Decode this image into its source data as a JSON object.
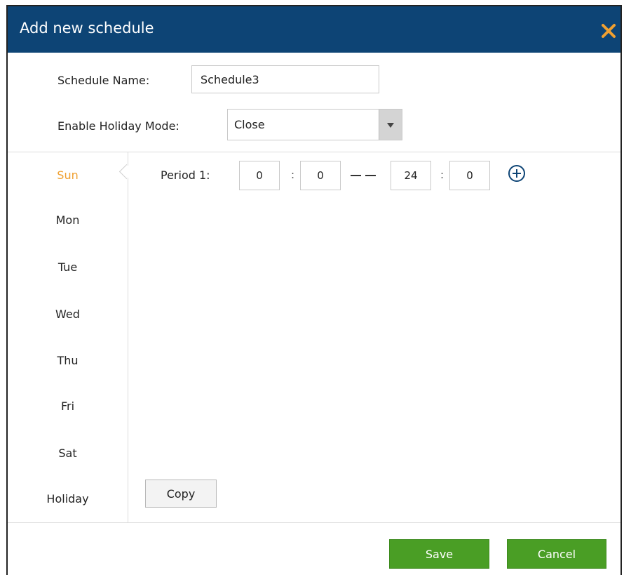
{
  "dialog": {
    "title": "Add new schedule",
    "close_icon": "close-x-icon",
    "accent_color": "#f0a030",
    "header_color": "#0d4475"
  },
  "form": {
    "schedule_name_label": "Schedule Name:",
    "schedule_name_value": "Schedule3",
    "holiday_mode_label": "Enable Holiday Mode:",
    "holiday_mode_value": "Close"
  },
  "days": [
    {
      "label": "Sun",
      "active": true
    },
    {
      "label": "Mon",
      "active": false
    },
    {
      "label": "Tue",
      "active": false
    },
    {
      "label": "Wed",
      "active": false
    },
    {
      "label": "Thu",
      "active": false
    },
    {
      "label": "Fri",
      "active": false
    },
    {
      "label": "Sat",
      "active": false
    },
    {
      "label": "Holiday",
      "active": false
    }
  ],
  "period": {
    "label": "Period 1:",
    "start_hour": "0",
    "start_minute": "0",
    "end_hour": "24",
    "end_minute": "0",
    "separator": ":",
    "add_icon": "plus-circle-icon"
  },
  "buttons": {
    "copy": "Copy",
    "save": "Save",
    "cancel": "Cancel",
    "green_color": "#4a9e25"
  }
}
